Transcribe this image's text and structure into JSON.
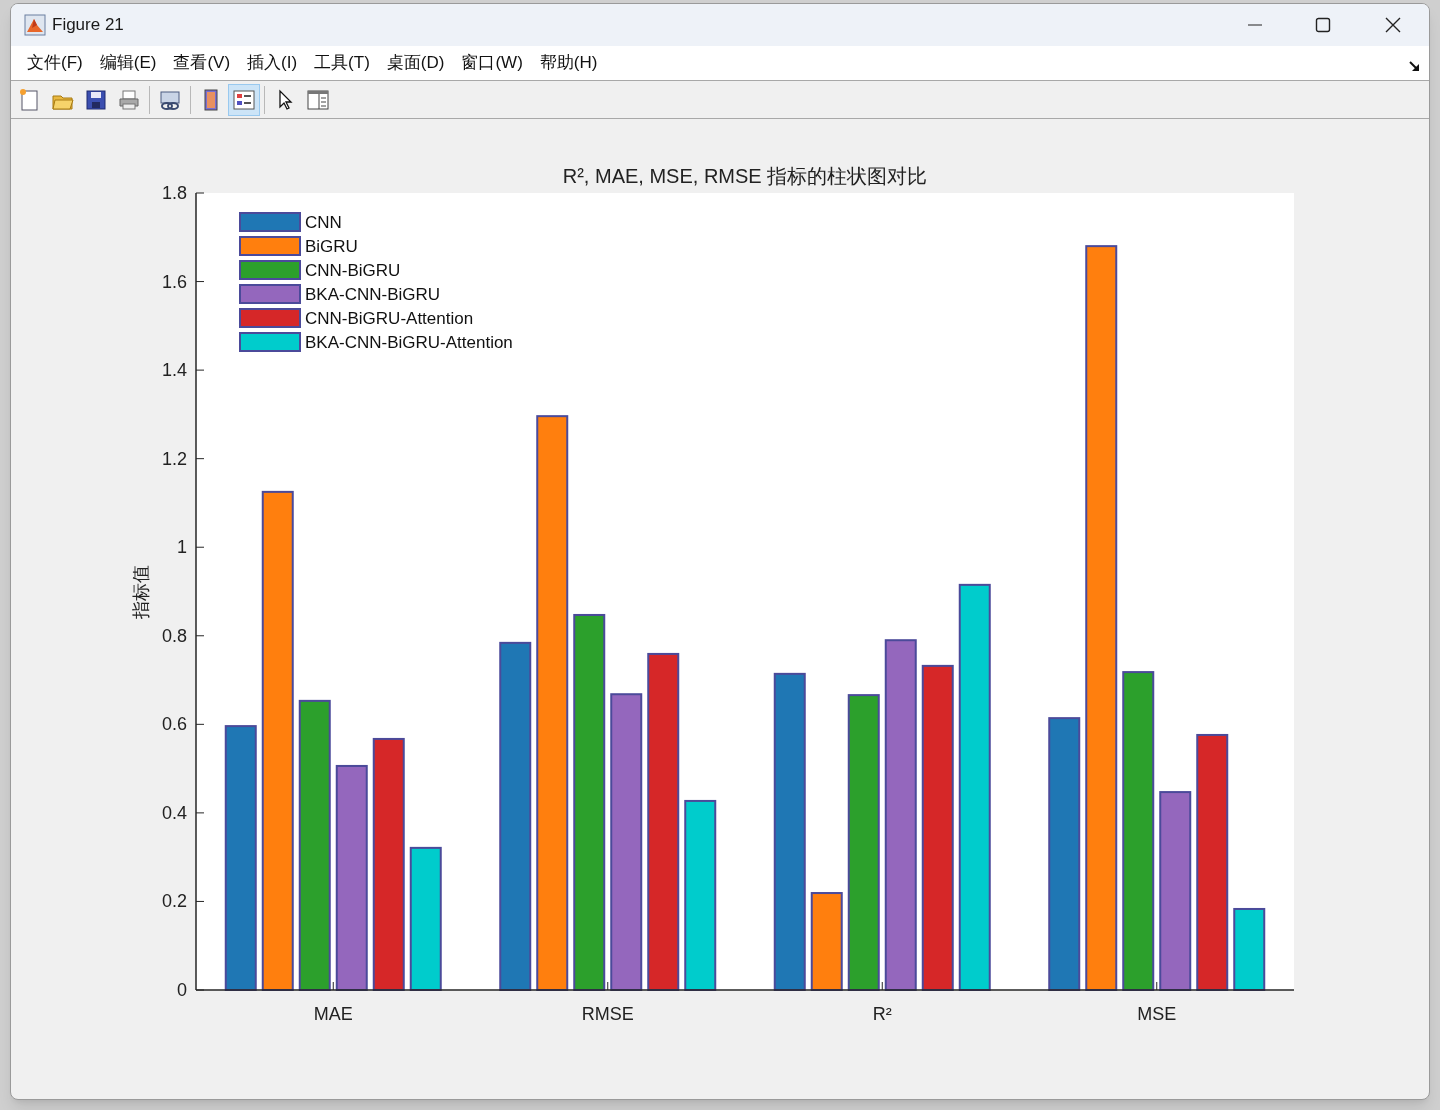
{
  "window": {
    "title": "Figure 21"
  },
  "menu": [
    "文件(F)",
    "编辑(E)",
    "查看(V)",
    "插入(I)",
    "工具(T)",
    "桌面(D)",
    "窗口(W)",
    "帮助(H)"
  ],
  "toolbar": [
    {
      "kind": "new",
      "selected": false
    },
    {
      "kind": "open",
      "selected": false
    },
    {
      "kind": "save",
      "selected": false
    },
    {
      "kind": "print",
      "selected": false
    },
    {
      "kind": "link",
      "selected": false
    },
    {
      "kind": "colorbar",
      "selected": false
    },
    {
      "kind": "legend",
      "selected": true
    },
    {
      "kind": "pointer",
      "selected": false
    },
    {
      "kind": "panel",
      "selected": false
    }
  ],
  "figure": {
    "chart_data": {
      "type": "bar",
      "title": "R², MAE, MSE, RMSE 指标的柱状图对比",
      "ylabel": "指标值",
      "categories": [
        "MAE",
        "RMSE",
        "R²",
        "MSE"
      ],
      "legend": "upper left",
      "ylim": [
        0,
        1.8
      ],
      "yticks": [
        0,
        0.2,
        0.4,
        0.6,
        0.8,
        1,
        1.2,
        1.4,
        1.6,
        1.8
      ],
      "series": [
        {
          "name": "CNN",
          "color": "#1f77b4",
          "values": [
            0.596,
            0.784,
            0.714,
            0.614
          ]
        },
        {
          "name": "BiGRU",
          "color": "#ff7f0e",
          "values": [
            1.125,
            1.296,
            0.219,
            1.68
          ]
        },
        {
          "name": "CNN-BiGRU",
          "color": "#2ca02c",
          "values": [
            0.653,
            0.847,
            0.666,
            0.718
          ]
        },
        {
          "name": "BKA-CNN-BiGRU",
          "color": "#9467bd",
          "values": [
            0.506,
            0.668,
            0.79,
            0.447
          ]
        },
        {
          "name": "CNN-BiGRU-Attention",
          "color": "#d62728",
          "values": [
            0.567,
            0.759,
            0.732,
            0.576
          ]
        },
        {
          "name": "BKA-CNN-BiGRU-Attention",
          "color": "#00cccc",
          "values": [
            0.321,
            0.427,
            0.915,
            0.183
          ]
        }
      ]
    }
  }
}
